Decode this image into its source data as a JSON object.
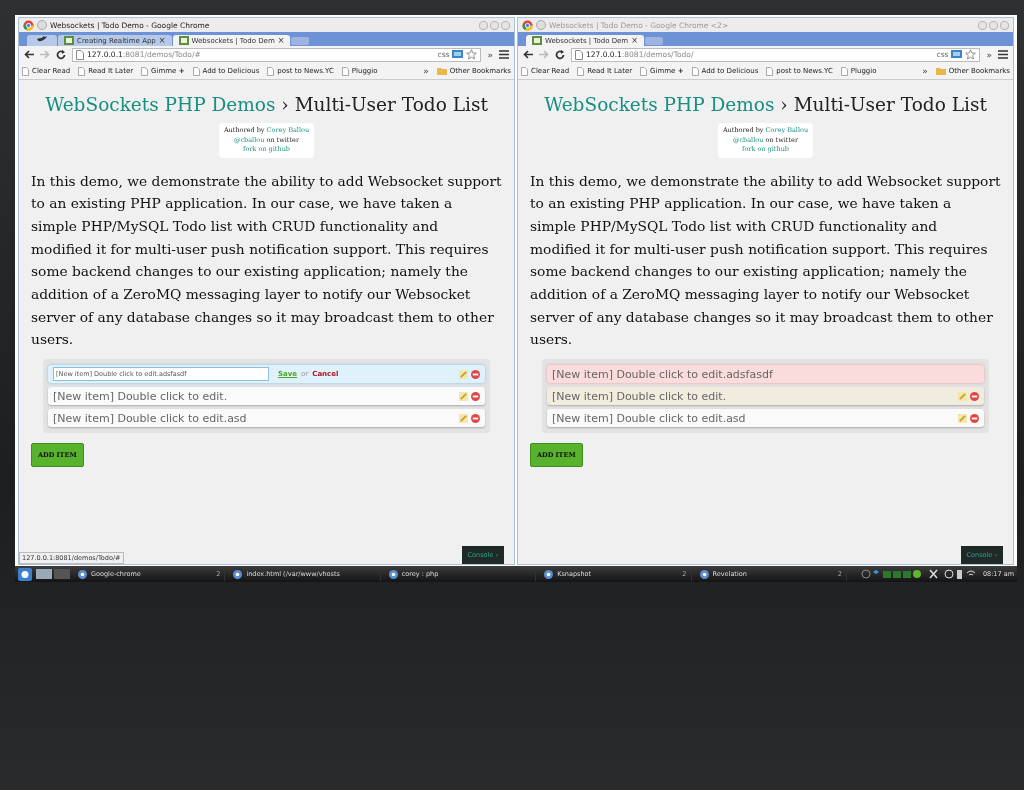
{
  "windows": [
    {
      "title": "Websockets | Todo Demo - Google Chrome",
      "active": true,
      "tabs": [
        {
          "kind": "icon",
          "selected": false
        },
        {
          "kind": "page",
          "label": "Creating Realtime App",
          "close": "×",
          "selected": false
        },
        {
          "kind": "page",
          "label": "Websockets | Todo Dem",
          "close": "×",
          "selected": true
        }
      ],
      "url_host": "127.0.0.1",
      "url_path": ":8081/demos/Todo/#",
      "extension_label": "css",
      "toolbar_overflow": "»",
      "bookmarks": [
        "Clear Read",
        "Read It Later",
        "Gimme **+**",
        "Add to Delicious",
        "post to News.YC",
        "Pluggio"
      ],
      "bookmarks_overflow": "»",
      "other_bookmarks": "Other Bookmarks",
      "page": {
        "brand": "WebSockets PHP Demos",
        "separator": "›",
        "title": "Multi-User Todo List",
        "author": {
          "label": "Authored by",
          "name": "Corey Ballou",
          "handle": "@cballou",
          "handle_suffix": "on twitter",
          "github": "fork on github"
        },
        "intro": "In this demo, we demonstrate the ability to add Websocket support to an existing PHP application. In our case, we have taken a simple PHP/MySQL Todo list with CRUD functionality and modified it for multi-user push notification support. This requires some backend changes to our existing application; namely the addition of a ZeroMQ messaging layer to notify our Websocket server of any database changes so it may broadcast them to other users.",
        "todos": [
          {
            "kind": "editing",
            "value": "[New item] Double click to edit.adsfasdf",
            "save": "Save",
            "or": "or",
            "cancel": "Cancel"
          },
          {
            "kind": "item",
            "text": "[New item] Double click to edit.",
            "locked": false,
            "highlighted": false
          },
          {
            "kind": "item",
            "text": "[New item] Double click to edit.asd",
            "locked": false,
            "highlighted": false
          }
        ],
        "add_button": "ADD ITEM",
        "console_button": "Console ›"
      },
      "status_url": "127.0.0.1:8081/demos/Todo/#"
    },
    {
      "title": "Websockets | Todo Demo - Google Chrome <2>",
      "active": false,
      "tabs": [
        {
          "kind": "page",
          "label": "Websockets | Todo Dem",
          "close": "×",
          "selected": true
        }
      ],
      "url_host": "127.0.0.1",
      "url_path": ":8081/demos/Todo/",
      "extension_label": "css",
      "toolbar_overflow": "»",
      "bookmarks": [
        "Clear Read",
        "Read It Later",
        "Gimme **+**",
        "Add to Delicious",
        "post to News.YC",
        "Pluggio"
      ],
      "bookmarks_overflow": "»",
      "other_bookmarks": "Other Bookmarks",
      "page": {
        "brand": "WebSockets PHP Demos",
        "separator": "›",
        "title": "Multi-User Todo List",
        "author": {
          "label": "Authored by",
          "name": "Corey Ballou",
          "handle": "@cballou",
          "handle_suffix": "on twitter",
          "github": "fork on github"
        },
        "intro": "In this demo, we demonstrate the ability to add Websocket support to an existing PHP application. In our case, we have taken a simple PHP/MySQL Todo list with CRUD functionality and modified it for multi-user push notification support. This requires some backend changes to our existing application; namely the addition of a ZeroMQ messaging layer to notify our Websocket server of any database changes so it may broadcast them to other users.",
        "todos": [
          {
            "kind": "item",
            "text": "[New item] Double click to edit.adsfasdf",
            "locked": true,
            "highlighted": false
          },
          {
            "kind": "item",
            "text": "[New item] Double click to edit.",
            "locked": false,
            "highlighted": true
          },
          {
            "kind": "item",
            "text": "[New item] Double click to edit.asd",
            "locked": false,
            "highlighted": false
          }
        ],
        "add_button": "ADD ITEM",
        "console_button": "Console ›"
      }
    }
  ],
  "taskbar": {
    "tasks": [
      {
        "label": "Google-chrome",
        "count": "2"
      },
      {
        "label": "index.html (/var/www/vhosts"
      },
      {
        "label": "corey : php"
      },
      {
        "label": "Ksnapshot",
        "count": "2"
      },
      {
        "label": "Revelation",
        "count": "2"
      }
    ],
    "clock": "08:17 am"
  }
}
